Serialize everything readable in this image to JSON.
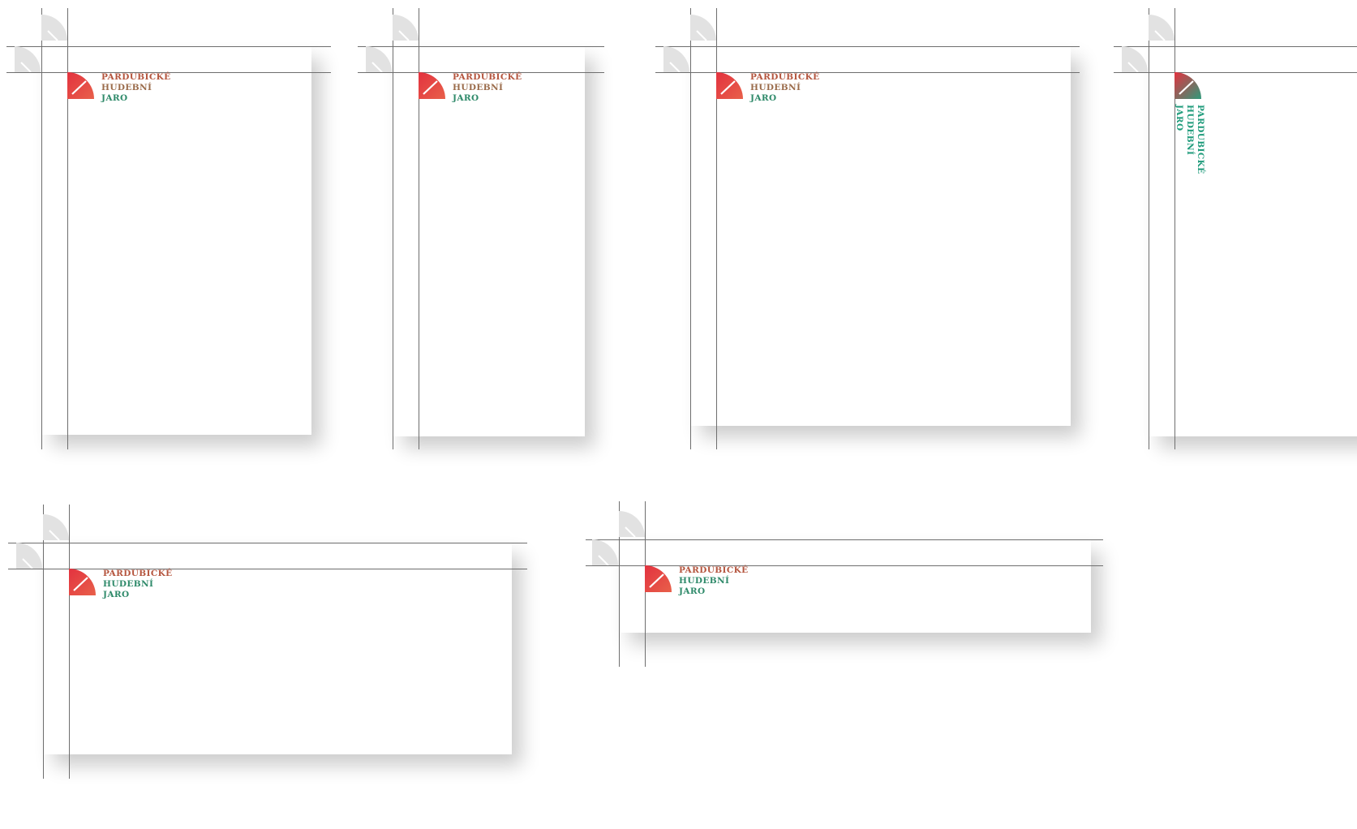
{
  "brand": {
    "lines": [
      "PARDUBICKÉ",
      "HUDEBNÍ",
      "JARO"
    ],
    "colors": {
      "mark_start": "#e3323f",
      "mark_end": "#e8604a",
      "mark_end_alt": "#2f9a7a",
      "text_left": "#b5563f",
      "text_right": "#1f9b7b",
      "guide_mark": "#e2e2e2",
      "guide_line": "#6e6e6e"
    },
    "icon": "quarter-circle-fan-logo-icon"
  },
  "mockups": [
    {
      "id": "portrait-a4",
      "logo_orientation": "horizontal"
    },
    {
      "id": "portrait-narrow",
      "logo_orientation": "horizontal"
    },
    {
      "id": "landscape-square",
      "logo_orientation": "horizontal"
    },
    {
      "id": "portrait-cropped-vertical-logo",
      "logo_orientation": "vertical"
    },
    {
      "id": "landscape-wide",
      "logo_orientation": "horizontal"
    },
    {
      "id": "banner-strip",
      "logo_orientation": "horizontal"
    }
  ]
}
